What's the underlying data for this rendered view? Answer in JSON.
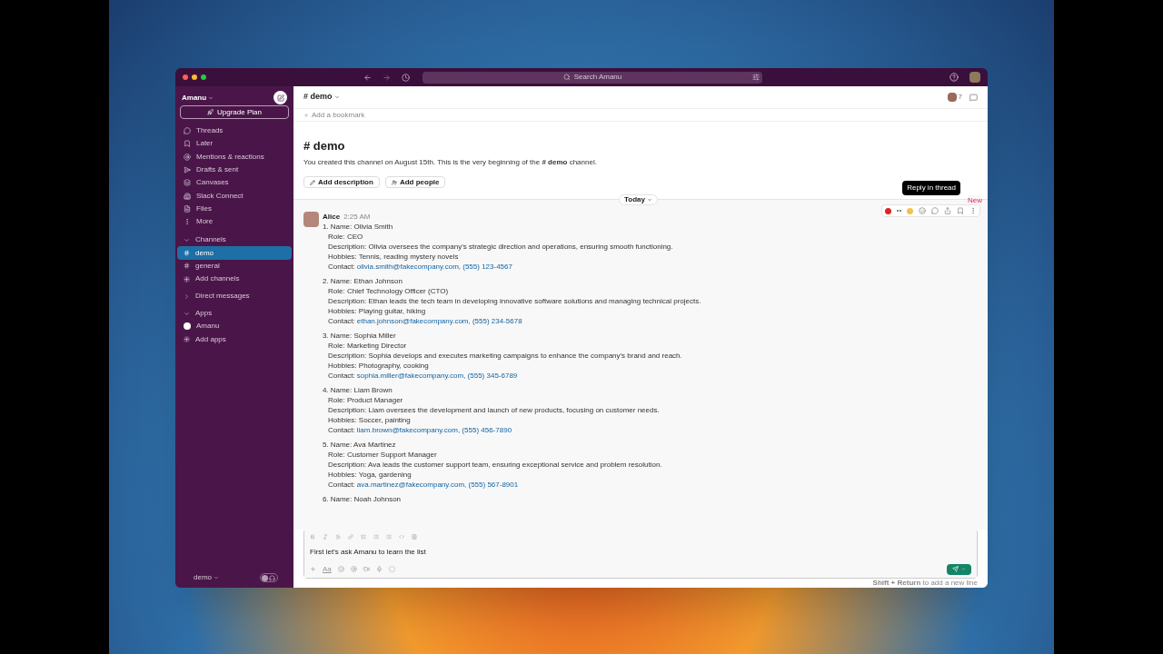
{
  "window": {
    "search_placeholder": "Search Amanu"
  },
  "sidebar": {
    "workspace": "Amanu",
    "upgrade": "Upgrade Plan",
    "nav": [
      {
        "label": "Threads",
        "kind": "threads"
      },
      {
        "label": "Later",
        "kind": "later"
      },
      {
        "label": "Mentions & reactions",
        "kind": "mentions"
      },
      {
        "label": "Drafts & sent",
        "kind": "drafts"
      },
      {
        "label": "Canvases",
        "kind": "canvases"
      },
      {
        "label": "Slack Connect",
        "kind": "connect"
      },
      {
        "label": "Files",
        "kind": "files"
      },
      {
        "label": "More",
        "kind": "more"
      }
    ],
    "sections": [
      {
        "label": "Channels",
        "expanded": true,
        "items": [
          {
            "label": "demo",
            "kind": "channel",
            "selected": true
          },
          {
            "label": "general",
            "kind": "channel",
            "selected": false
          },
          {
            "label": "Add channels",
            "kind": "add",
            "selected": false
          }
        ]
      },
      {
        "label": "Direct messages",
        "expanded": false
      },
      {
        "label": "Apps",
        "expanded": true,
        "items": [
          {
            "label": "Amanu",
            "kind": "app",
            "selected": false
          },
          {
            "label": "Add apps",
            "kind": "add",
            "selected": false
          }
        ]
      }
    ],
    "footer": "demo",
    "huddle_on": false
  },
  "channel": {
    "name": "# demo",
    "member_count": "7",
    "bookmark": "Add a bookmark"
  },
  "intro": {
    "title": "# demo",
    "text": "You created this channel on August 15th. This is the very beginning of the **# demo** channel.",
    "buttons": [
      {
        "label": "Add description",
        "kind": "edit"
      },
      {
        "label": "Add people",
        "kind": "people"
      }
    ]
  },
  "divider": {
    "label": "Today",
    "new_label": "New"
  },
  "tooltip": "Reply in thread",
  "message": {
    "author": "Alice",
    "time": "2:25 AM",
    "entries": [
      {
        "number": "1.",
        "name": "Name: Olivia Smith",
        "role": "Role: CEO",
        "description": "Description: Olivia oversees the company's strategic direction and operations, ensuring smooth functioning.",
        "hobbies": "Hobbies: Tennis, reading mystery novels",
        "contact_label": "Contact:",
        "contact": "olivia.smith@fakecompany.com, (555) 123-4567"
      },
      {
        "number": "2.",
        "name": "Name: Ethan Johnson",
        "role": "Role: Chief Technology Officer (CTO)",
        "description": "Description: Ethan leads the tech team in developing innovative software solutions and managing technical projects.",
        "hobbies": "Hobbies: Playing guitar, hiking",
        "contact_label": "Contact:",
        "contact": "ethan.johnson@fakecompany.com, (555) 234-5678"
      },
      {
        "number": "3.",
        "name": "Name: Sophia Miller",
        "role": "Role: Marketing Director",
        "description": "Description: Sophia develops and executes marketing campaigns to enhance the company's brand and reach.",
        "hobbies": "Hobbies: Photography, cooking",
        "contact_label": "Contact:",
        "contact": "sophia.miller@fakecompany.com, (555) 345-6789"
      },
      {
        "number": "4.",
        "name": "Name: Liam Brown",
        "role": "Role: Product Manager",
        "description": "Description: Liam oversees the development and launch of new products, focusing on customer needs.",
        "hobbies": "Hobbies: Soccer, painting",
        "contact_label": "Contact:",
        "contact": "liam.brown@fakecompany.com, (555) 456-7890"
      },
      {
        "number": "5.",
        "name": "Name: Ava Martinez",
        "role": "Role: Customer Support Manager",
        "description": "Description: Ava leads the customer support team, ensuring exceptional service and problem resolution.",
        "hobbies": "Hobbies: Yoga, gardening",
        "contact_label": "Contact:",
        "contact": "ava.martinez@fakecompany.com, (555) 567-8901"
      },
      {
        "number": "6.",
        "name": "Name: Noah Johnson"
      }
    ]
  },
  "composer": {
    "format_label": "Aa",
    "value": "First let's ask Amanu to learn the list",
    "hint": "**Shift + Return** to add a new line"
  }
}
